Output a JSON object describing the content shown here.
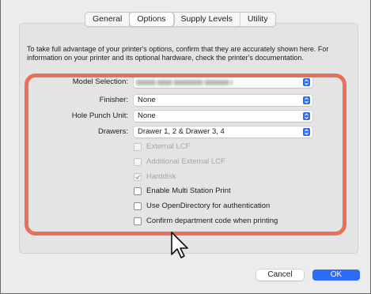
{
  "tabs": [
    "General",
    "Options",
    "Supply Levels",
    "Utility"
  ],
  "active_tab": "Options",
  "description": "To take full advantage of your printer's options, confirm that they are accurately shown here. For information on your printer and its optional hardware, check the printer's documentation.",
  "fields": {
    "model_selection": {
      "label": "Model Selection:",
      "value": ""
    },
    "finisher": {
      "label": "Finisher:",
      "value": "None"
    },
    "hole_punch": {
      "label": "Hole Punch Unit:",
      "value": "None"
    },
    "drawers": {
      "label": "Drawers:",
      "value": "Drawer 1, 2 & Drawer 3, 4"
    }
  },
  "checkboxes": [
    {
      "label": "External LCF",
      "checked": false,
      "enabled": false
    },
    {
      "label": "Additional External LCF",
      "checked": false,
      "enabled": false
    },
    {
      "label": "Harddisk",
      "checked": true,
      "enabled": false
    },
    {
      "label": "Enable Multi Station Print",
      "checked": false,
      "enabled": true
    },
    {
      "label": "Use OpenDirectory for authentication",
      "checked": false,
      "enabled": true
    },
    {
      "label": "Confirm department code when printing",
      "checked": false,
      "enabled": true
    }
  ],
  "buttons": {
    "cancel": "Cancel",
    "ok": "OK"
  },
  "colors": {
    "accent": "#2f6cf5",
    "highlight": "#e8705c"
  },
  "icons": {
    "stepper": "chevron-up-down-icon",
    "cursor": "mouse-pointer-icon"
  }
}
